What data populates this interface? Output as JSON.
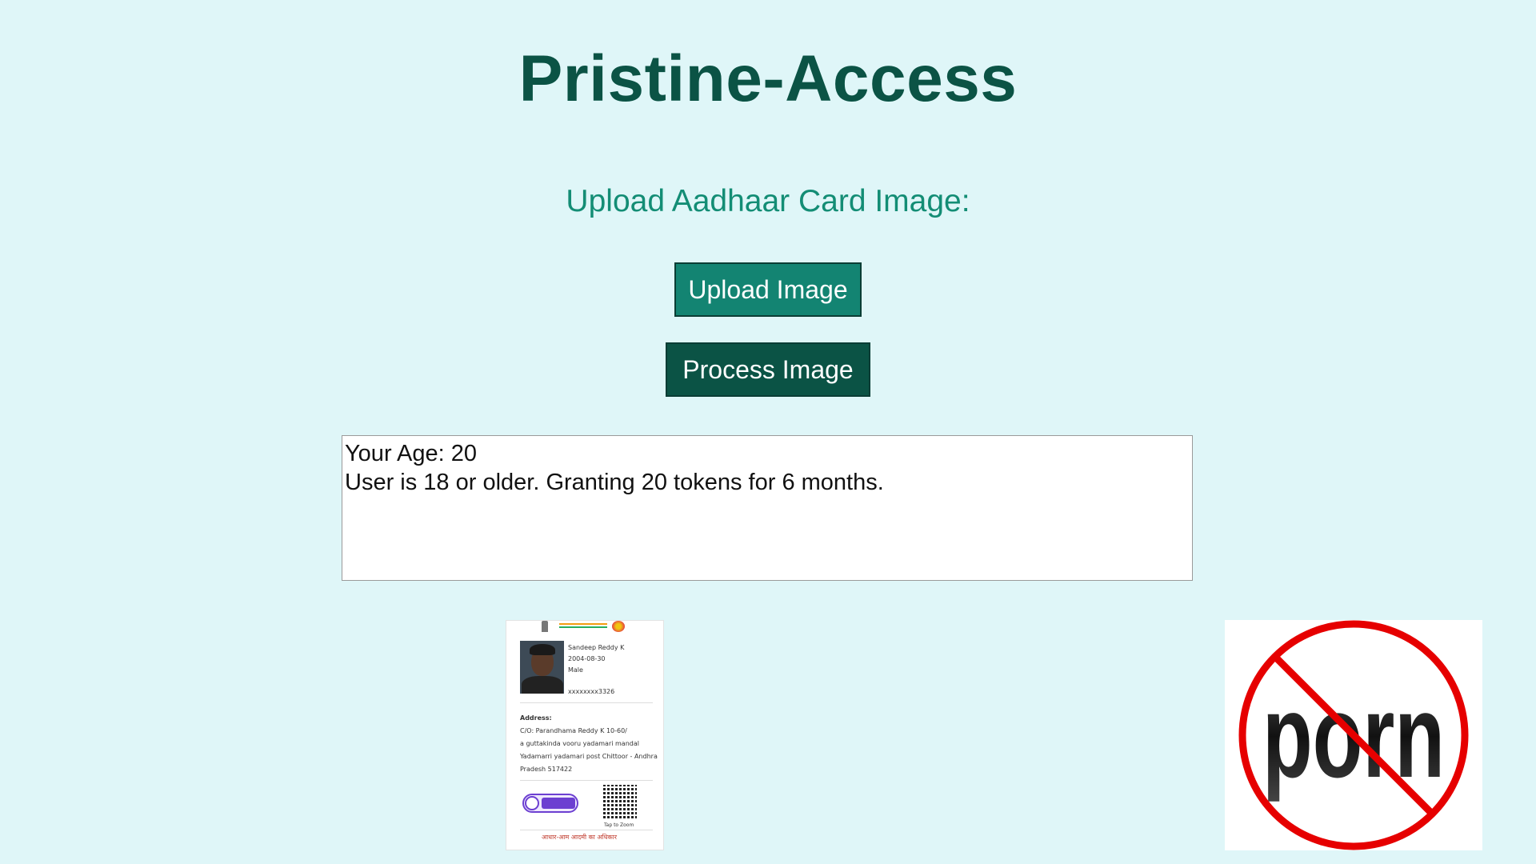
{
  "app": {
    "title": "Pristine-Access"
  },
  "upload": {
    "label": "Upload Aadhaar Card Image:",
    "upload_button": "Upload Image",
    "process_button": "Process Image"
  },
  "result": {
    "age_line": "Your Age: 20",
    "status_line": "User is 18 or older. Granting 20 tokens for 6 months."
  },
  "aadhaar_card": {
    "name": "Sandeep Reddy K",
    "dob": "2004-08-30",
    "gender": "Male",
    "number": "xxxxxxxx3326",
    "address_heading": "Address:",
    "address_lines": [
      "C/O: Parandhama Reddy K 10-60/",
      "a guttakinda vooru yadamari mandal",
      "Yadamarri yadamari post Chittoor - Andhra",
      "Pradesh 517422"
    ],
    "qr_caption": "Tap to Zoom",
    "verified_icon": "verified-badge-icon",
    "footer": "आधार-आम आदमी का अधिकार"
  },
  "sign": {
    "text": "porn",
    "icon": "prohibition-sign-icon",
    "ring_color": "#e60000"
  },
  "colors": {
    "background": "#dff6f8",
    "title": "#0b5345",
    "label": "#138d75",
    "upload_button": "#138472",
    "process_button": "#0b5345"
  }
}
